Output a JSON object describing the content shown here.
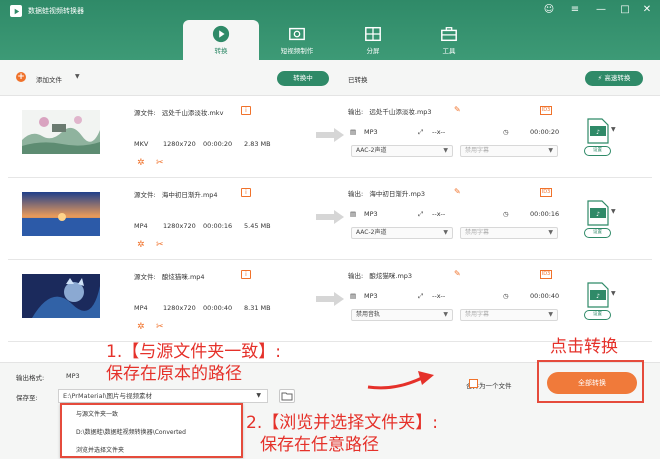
{
  "app": {
    "title": "数据蛙视频转换器"
  },
  "window_controls": [
    "☺",
    "≡",
    "—",
    "□",
    "✕"
  ],
  "nav": [
    {
      "label": "转换",
      "icon": "convert-icon",
      "active": true
    },
    {
      "label": "短视频制作",
      "icon": "film-icon",
      "active": false
    },
    {
      "label": "分屏",
      "icon": "split-screen-icon",
      "active": false
    },
    {
      "label": "工具",
      "icon": "toolbox-icon",
      "active": false
    }
  ],
  "toolbar": {
    "add_file": "添加文件",
    "tab_converting": "转换中",
    "tab_converted": "已转换",
    "fast_convert": "高速转换"
  },
  "files": [
    {
      "source_label": "源文件:",
      "source_name": "远处千山添淡妆.mkv",
      "format": "MKV",
      "resolution": "1280x720",
      "duration": "00:00:20",
      "size": "2.83 MB",
      "output_label": "输出:",
      "output_name": "远处千山添淡妆.mp3",
      "out_format": "MP3",
      "out_res": "--x--",
      "out_duration": "00:00:20",
      "audio_track": "AAC-2声道",
      "subtitle": "禁用字幕",
      "settings": "设置"
    },
    {
      "source_label": "源文件:",
      "source_name": "海中初日渐升.mp4",
      "format": "MP4",
      "resolution": "1280x720",
      "duration": "00:00:16",
      "size": "5.45 MB",
      "output_label": "输出:",
      "output_name": "海中初日渐升.mp3",
      "out_format": "MP3",
      "out_res": "--x--",
      "out_duration": "00:00:16",
      "audio_track": "AAC-2声道",
      "subtitle": "禁用字幕",
      "settings": "设置"
    },
    {
      "source_label": "源文件:",
      "source_name": "酿炫猫咪.mp4",
      "format": "MP4",
      "resolution": "1280x720",
      "duration": "00:00:40",
      "size": "8.31 MB",
      "output_label": "输出:",
      "output_name": "酿炫猫咪.mp3",
      "out_format": "MP3",
      "out_res": "--x--",
      "out_duration": "00:00:40",
      "audio_track": "禁用音轨",
      "subtitle": "禁用字幕",
      "settings": "设置"
    }
  ],
  "footer": {
    "output_format_label": "输出格式:",
    "output_format_value": "MP3",
    "save_to_label": "保存至:",
    "save_path": "E:\\PrMaterial\\图片与视频素材",
    "merge_label": "合并为一个文件",
    "convert_all": "全部转换"
  },
  "save_dropdown": [
    "与源文件夹一致",
    "D:\\数据蛙\\数据蛙视频转换器\\Converted",
    "浏览并选择文件夹"
  ],
  "annotations": {
    "one_line1": "1.【与源文件夹一致】:",
    "one_line2": "保存在原本的路径",
    "two_line1": "2.【浏览并选择文件夹】:",
    "two_line2": "保存在任意路径",
    "click_convert": "点击转换"
  },
  "colors": {
    "brand_green": "#2f8a68",
    "accent_orange": "#f0722b",
    "annotation_red": "#e5312a"
  }
}
